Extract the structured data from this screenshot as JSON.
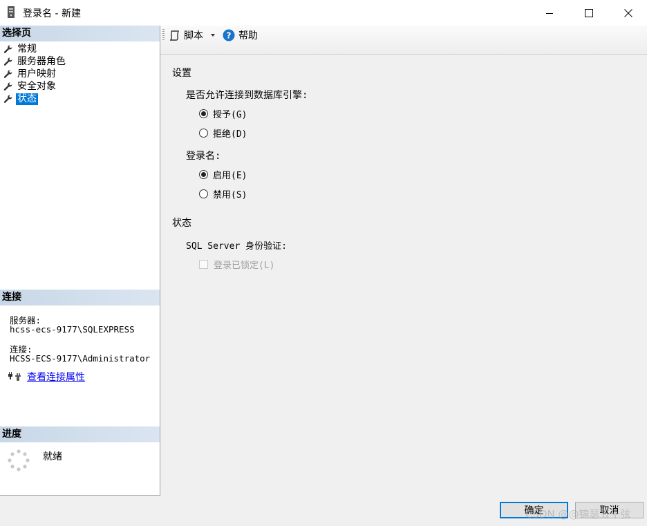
{
  "window": {
    "title": "登录名 - 新建",
    "icon": "server-icon",
    "controls": {
      "minimize": "minimize-icon",
      "maximize": "maximize-icon",
      "close": "close-icon"
    }
  },
  "sidebar": {
    "select_page_header": "选择页",
    "pages": [
      {
        "label": "常规",
        "selected": false
      },
      {
        "label": "服务器角色",
        "selected": false
      },
      {
        "label": "用户映射",
        "selected": false
      },
      {
        "label": "安全对象",
        "selected": false
      },
      {
        "label": "状态",
        "selected": true
      }
    ],
    "connection_header": "连接",
    "server_label": "服务器:",
    "server_value": "hcss-ecs-9177\\SQLEXPRESS",
    "connection_label": "连接:",
    "connection_value": "HCSS-ECS-9177\\Administrator",
    "view_properties_link": "查看连接属性",
    "progress_header": "进度",
    "progress_status": "就绪"
  },
  "toolbar": {
    "script_label": "脚本",
    "help_label": "帮助"
  },
  "main": {
    "settings_heading": "设置",
    "permission_question": "是否允许连接到数据库引擎:",
    "permission_options": [
      {
        "label": "授予(G)",
        "selected": true
      },
      {
        "label": "拒绝(D)",
        "selected": false
      }
    ],
    "login_heading": "登录名:",
    "login_options": [
      {
        "label": "启用(E)",
        "selected": true
      },
      {
        "label": "禁用(S)",
        "selected": false
      }
    ],
    "status_heading": "状态",
    "sql_auth_label": "SQL Server 身份验证:",
    "locked_checkbox_label": "登录已锁定(L)",
    "locked_checked": false
  },
  "footer": {
    "ok_label": "确定",
    "cancel_label": "取消",
    "watermark": "CSDN @@锦瑟五十弦"
  },
  "colors": {
    "selection": "#0078d7",
    "header_gradient": "#c8d7e7",
    "link": "#0000ee",
    "help_icon": "#1a73c8"
  }
}
